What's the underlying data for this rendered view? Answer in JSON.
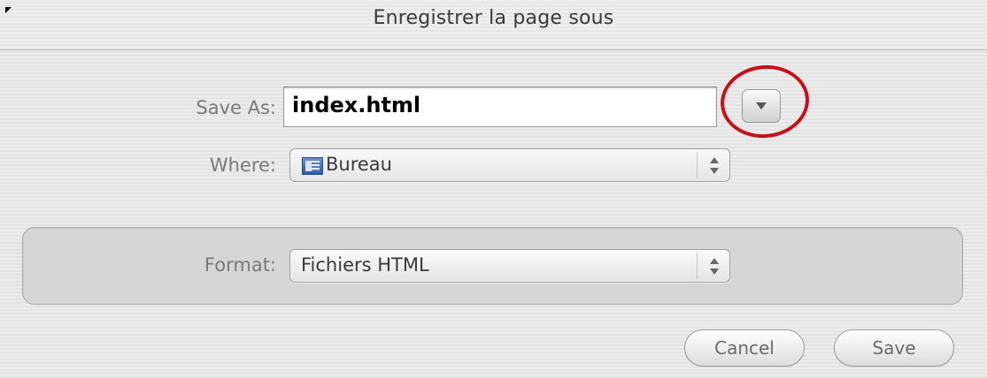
{
  "dialog": {
    "title": "Enregistrer la page sous"
  },
  "save_as": {
    "label": "Save As:",
    "value": "index.html"
  },
  "where": {
    "label": "Where:",
    "selected": "Bureau",
    "icon": "desktop-folder-icon"
  },
  "format": {
    "label": "Format:",
    "selected": "Fichiers HTML"
  },
  "buttons": {
    "cancel": "Cancel",
    "save": "Save"
  },
  "annotation": {
    "color": "#c8101a"
  }
}
